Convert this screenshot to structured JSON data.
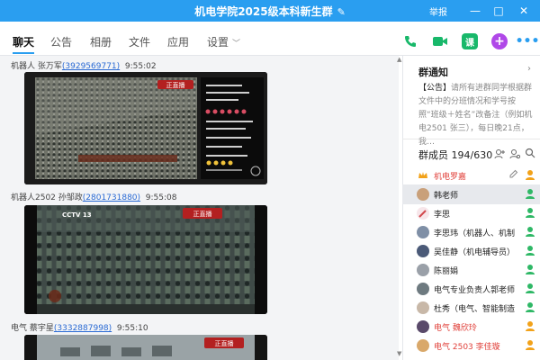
{
  "window": {
    "title": "机电学院2025级本科新生群",
    "report_label": "举报",
    "controls": {
      "minimize": "—",
      "maximize": "□",
      "close": "✕"
    }
  },
  "tabs": [
    {
      "label": "聊天",
      "active": true
    },
    {
      "label": "公告"
    },
    {
      "label": "相册"
    },
    {
      "label": "文件"
    },
    {
      "label": "应用"
    },
    {
      "label": "设置"
    }
  ],
  "toolbar": {
    "icons": [
      "phone-icon",
      "video-icon",
      "class-icon",
      "add-icon",
      "more-icon"
    ],
    "class_label": "课",
    "colors": {
      "phone": "#18b86a",
      "video": "#18b86a",
      "class": "#18b86a",
      "add": "#b048e8",
      "more": "#2a9ef0"
    }
  },
  "chat": {
    "messages": [
      {
        "sender": "机器人 张万军",
        "uid": "(3929569771)",
        "time": "9:55:02",
        "image": "livestream-parade-comments"
      },
      {
        "sender": "机器人2502 孙邹政",
        "uid": "(2801731880)",
        "time": "9:55:08",
        "image": "cctv-parade-soldiers"
      },
      {
        "sender": "电气 蔡宇星",
        "uid": "(3332887998)",
        "time": "9:55:10",
        "image": "parade-vehicles"
      }
    ],
    "overlays": {
      "live_badge": "正直播",
      "channel_mark": "CCTV 13"
    }
  },
  "side_panel": {
    "notice": {
      "title": "群通知",
      "tag": "【公告】",
      "text": "请所有进群同学根据群文件中的分班情况和学号按照“班级＋姓名”改备注（例如机电2501 张三），每日晚21点，我…"
    },
    "members": {
      "title": "群成员 194/630",
      "list": [
        {
          "name": "机电罗嘉",
          "color": "#e0403a",
          "role": "owner"
        },
        {
          "name": "韩老师",
          "color": "#222222",
          "role": "admin",
          "selected": true
        },
        {
          "name": "李思",
          "color": "#222222",
          "role": "admin"
        },
        {
          "name": "李思玮（机器人、机制",
          "color": "#222222",
          "role": "admin"
        },
        {
          "name": "吴佳静（机电辅导员）",
          "color": "#222222",
          "role": "admin"
        },
        {
          "name": "陈丽娟",
          "color": "#222222",
          "role": "admin"
        },
        {
          "name": "电气专业负责人郭老师",
          "color": "#222222",
          "role": "admin"
        },
        {
          "name": "杜秀（电气、智能制造",
          "color": "#222222",
          "role": "admin"
        },
        {
          "name": "电气 魏欣玲",
          "color": "#e0403a",
          "role": "member"
        },
        {
          "name": "电气 2503 李佳璇",
          "color": "#e0403a",
          "role": "member"
        }
      ]
    }
  }
}
